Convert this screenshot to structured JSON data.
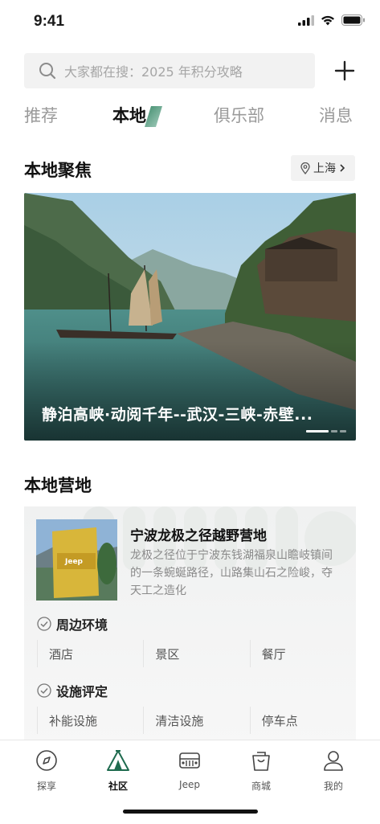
{
  "status_bar": {
    "time": "9:41"
  },
  "search": {
    "placeholder": "大家都在搜：2025 年积分攻略"
  },
  "tabs": [
    {
      "label": "推荐",
      "active": false
    },
    {
      "label": "本地",
      "active": true
    },
    {
      "label": "俱乐部",
      "active": false
    },
    {
      "label": "消息",
      "active": false
    }
  ],
  "local_focus": {
    "title": "本地聚焦",
    "location": "上海",
    "banner_title": "静泊高峡·动阅千年--武汉-三峡-赤壁...",
    "carousel": {
      "total": 3,
      "current": 1
    }
  },
  "local_camp": {
    "title": "本地营地",
    "card": {
      "name": "宁波龙极之径越野营地",
      "description": "龙极之径位于宁波东钱湖福泉山瞻岐镇间的一条蜿蜒路径，山路集山石之险峻，夺天工之造化",
      "surroundings_label": "周边环境",
      "surroundings": [
        "酒店",
        "景区",
        "餐厅"
      ],
      "facilities_label": "设施评定",
      "facilities": [
        "补能设施",
        "清洁设施",
        "停车点"
      ]
    }
  },
  "tabbar": [
    {
      "label": "探享",
      "icon": "compass-icon",
      "active": false
    },
    {
      "label": "社区",
      "icon": "tent-icon",
      "active": true
    },
    {
      "label": "Jeep",
      "icon": "jeep-icon",
      "active": false
    },
    {
      "label": "商城",
      "icon": "shopping-bag-icon",
      "active": false
    },
    {
      "label": "我的",
      "icon": "user-icon",
      "active": false
    }
  ],
  "colors": {
    "accent": "#1f6b4f",
    "text": "#111111",
    "muted": "#9a9a9a"
  }
}
